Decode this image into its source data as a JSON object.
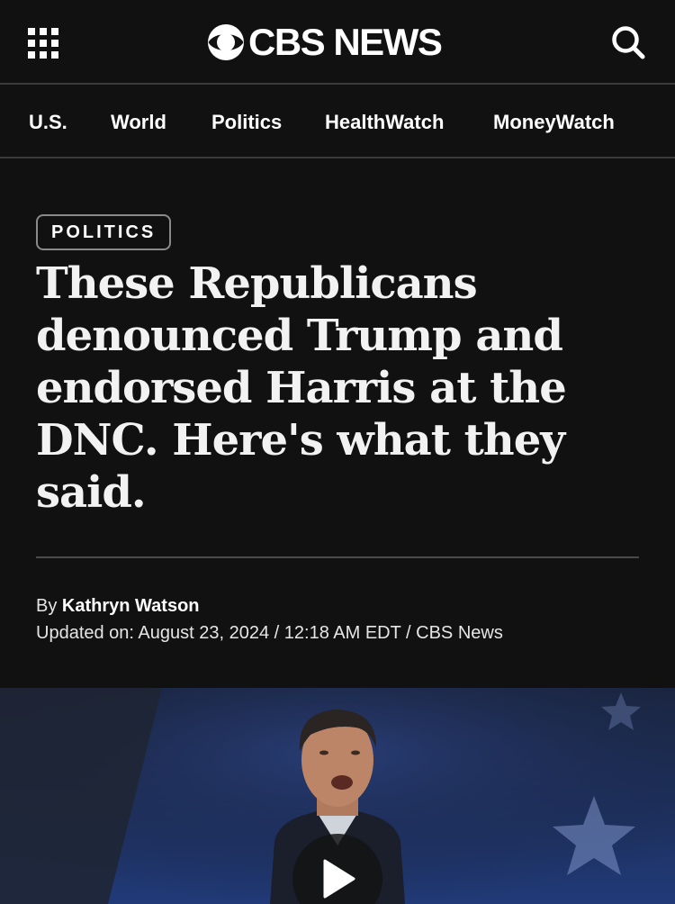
{
  "header": {
    "logo_text": "CBS NEWS",
    "apps_icon": "grid-apps-icon",
    "search_icon": "search-icon"
  },
  "nav": {
    "items": [
      {
        "label": "U.S."
      },
      {
        "label": "World"
      },
      {
        "label": "Politics"
      },
      {
        "label": "HealthWatch"
      },
      {
        "label": "MoneyWatch"
      }
    ]
  },
  "article": {
    "category": "POLITICS",
    "headline": "These Republicans denounced Trump and endorsed Harris at the DNC. Here's what they said.",
    "byline_prefix": "By ",
    "author": "Kathryn Watson",
    "updated": "Updated on: August 23, 2024 / 12:18 AM EDT / CBS News"
  },
  "media": {
    "play_icon": "play-icon"
  },
  "colors": {
    "background": "#111111",
    "text": "#ffffff",
    "divider": "#3a3a3a",
    "tag_border": "#8a8a8a"
  }
}
